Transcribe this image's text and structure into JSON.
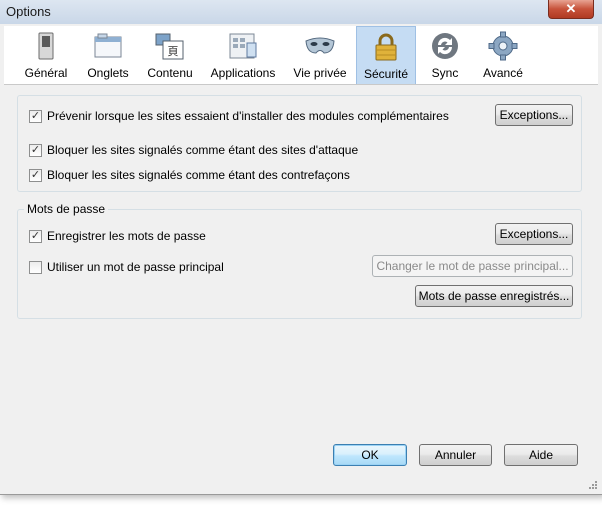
{
  "window": {
    "title": "Options",
    "close_glyph": "✕"
  },
  "tabs": [
    {
      "label": "Général",
      "icon": "switch-icon"
    },
    {
      "label": "Onglets",
      "icon": "tabs-window-icon"
    },
    {
      "label": "Contenu",
      "icon": "content-icon"
    },
    {
      "label": "Applications",
      "icon": "applications-icon"
    },
    {
      "label": "Vie privée",
      "icon": "mask-icon"
    },
    {
      "label": "Sécurité",
      "icon": "padlock-icon",
      "active": true
    },
    {
      "label": "Sync",
      "icon": "sync-icon"
    },
    {
      "label": "Avancé",
      "icon": "gear-icon"
    }
  ],
  "security": {
    "warn_addons": {
      "label": "Prévenir lorsque les sites essaient d'installer des modules complémentaires",
      "checked": true
    },
    "addons_exceptions": "Exceptions...",
    "block_attack": {
      "label": "Bloquer les sites signalés comme étant des sites d'attaque",
      "checked": true
    },
    "block_forgery": {
      "label": "Bloquer les sites signalés comme étant des contrefaçons",
      "checked": true
    }
  },
  "passwords": {
    "group_title": "Mots de passe",
    "remember": {
      "label": "Enregistrer les mots de passe",
      "checked": true
    },
    "exceptions": "Exceptions...",
    "master": {
      "label": "Utiliser un mot de passe principal",
      "checked": false
    },
    "change_master": "Changer le mot de passe principal...",
    "saved": "Mots de passe enregistrés..."
  },
  "footer": {
    "ok": "OK",
    "cancel": "Annuler",
    "help": "Aide"
  },
  "check_glyph": "✓"
}
